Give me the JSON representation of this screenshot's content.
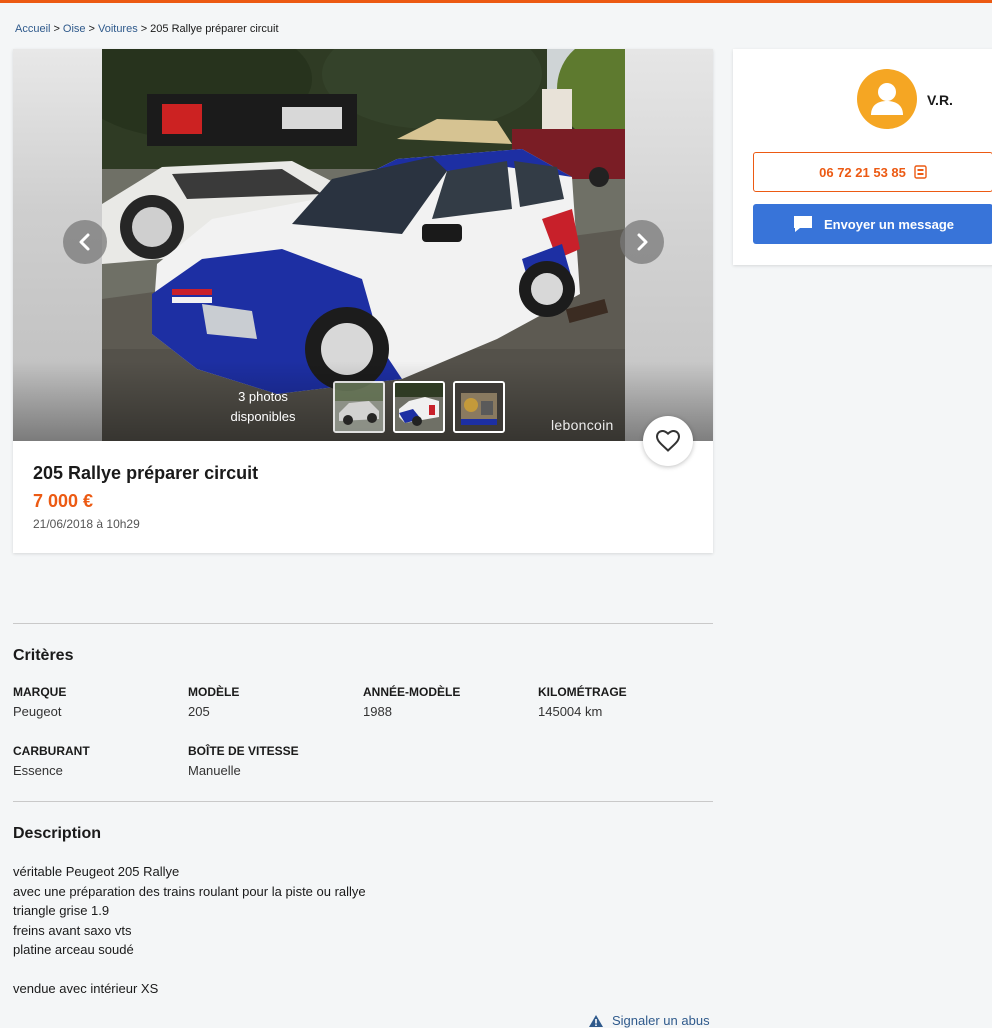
{
  "breadcrumb": {
    "home": "Accueil",
    "region": "Oise",
    "category": "Voitures",
    "current": "205 Rallye préparer circuit",
    "separator": ">"
  },
  "gallery": {
    "photo_count_line1": "3 photos",
    "photo_count_line2": "disponibles",
    "watermark": "leboncoin",
    "current_index": 2,
    "total": 3
  },
  "ad": {
    "title": "205 Rallye préparer circuit",
    "price": "7 000 €",
    "date": "21/06/2018 à 10h29"
  },
  "seller": {
    "name": "V.R.",
    "phone": "06 72 21 53 85",
    "message_label": "Envoyer un message"
  },
  "criteria": {
    "title": "Critères",
    "items": [
      {
        "label": "MARQUE",
        "value": "Peugeot"
      },
      {
        "label": "MODÈLE",
        "value": "205"
      },
      {
        "label": "ANNÉE-MODÈLE",
        "value": "1988"
      },
      {
        "label": "KILOMÉTRAGE",
        "value": "145004 km"
      },
      {
        "label": "CARBURANT",
        "value": "Essence"
      },
      {
        "label": "BOÎTE DE VITESSE",
        "value": "Manuelle"
      }
    ]
  },
  "description": {
    "title": "Description",
    "lines": [
      "véritable Peugeot 205 Rallye",
      "avec une préparation des trains roulant pour la piste ou rallye",
      "triangle grise 1.9",
      "freins avant saxo vts",
      "platine arceau soudé",
      "",
      "vendue avec intérieur XS"
    ]
  },
  "report_label": "Signaler un abus",
  "colors": {
    "accent": "#ec5a13",
    "message_button": "#3874d9",
    "link": "#2f5a8c",
    "avatar": "#f5a623"
  }
}
